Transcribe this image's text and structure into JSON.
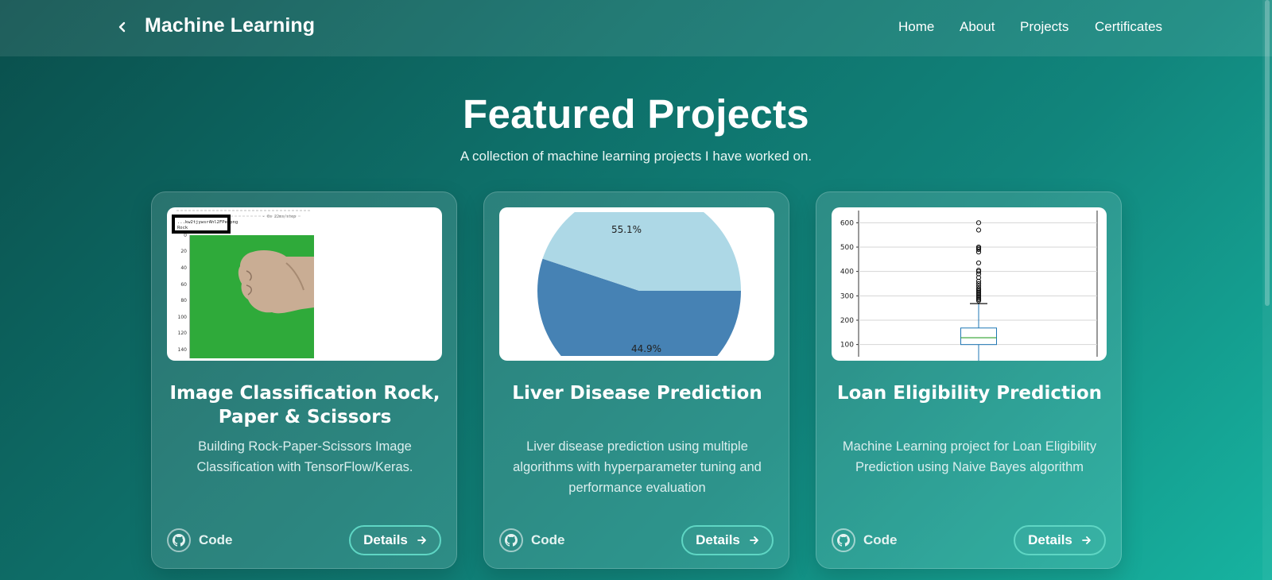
{
  "nav": {
    "title": "Machine Learning",
    "links": [
      "Home",
      "About",
      "Projects",
      "Certificates"
    ]
  },
  "hero": {
    "title": "Featured Projects",
    "subtitle": "A collection of machine learning projects I have worked on."
  },
  "projects": [
    {
      "title": "Image Classification Rock, Paper & Scissors",
      "description": "Building Rock-Paper-Scissors Image Classification with TensorFlow/Keras.",
      "code_label": "Code",
      "details_label": "Details",
      "image": {
        "filename": "...kw2tjywsrAhl2FPe.png",
        "caption": "Rock",
        "yticks": [
          "0",
          "20",
          "40",
          "60",
          "80",
          "100",
          "120",
          "140"
        ]
      }
    },
    {
      "title": "Liver Disease Prediction",
      "description": "Liver disease prediction using multiple algorithms with hyperparameter tuning and performance evaluation",
      "code_label": "Code",
      "details_label": "Details",
      "image": {
        "chart_data": {
          "type": "pie",
          "slices": [
            {
              "label": "55.1%",
              "value": 55.1,
              "color": "#4682b4"
            },
            {
              "label": "44.9%",
              "value": 44.9,
              "color": "#add8e6"
            }
          ]
        }
      }
    },
    {
      "title": "Loan Eligibility Prediction",
      "description": "Machine Learning project for Loan Eligibility Prediction using Naive Bayes algorithm",
      "code_label": "Code",
      "details_label": "Details",
      "image": {
        "chart_data": {
          "type": "boxplot",
          "yticks": [
            "100",
            "200",
            "300",
            "400",
            "500",
            "600"
          ],
          "ylim": [
            50,
            650
          ],
          "box": {
            "min": 25,
            "q1": 100,
            "median": 128,
            "q3": 168,
            "max": 268
          },
          "outliers": [
            280,
            285,
            290,
            295,
            300,
            305,
            310,
            315,
            320,
            325,
            330,
            340,
            350,
            360,
            375,
            390,
            400,
            405,
            435,
            480,
            490,
            495,
            500,
            570,
            600
          ]
        }
      }
    }
  ]
}
